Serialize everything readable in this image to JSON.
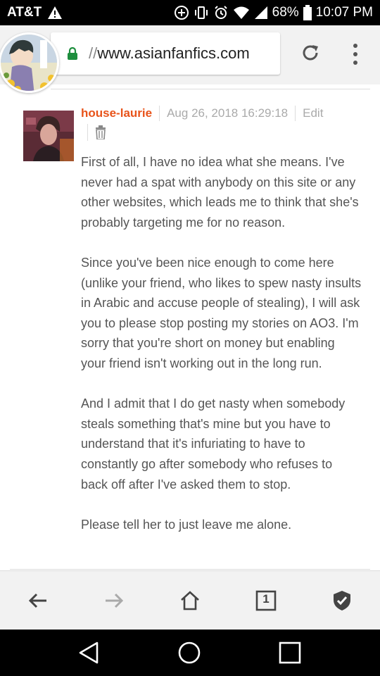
{
  "status_bar": {
    "carrier": "AT&T",
    "battery": "68%",
    "time": "10:07 PM"
  },
  "browser": {
    "url_prefix": "//",
    "url_domain": "www.asianfanfics.com"
  },
  "comment": {
    "author": "house-laurie",
    "timestamp": "Aug 26, 2018 16:29:18",
    "edit_label": "Edit",
    "paragraphs": [
      "First of all, I have no idea what she means. I've never had a spat with anybody on this site or any other websites, which leads me to think that she's probably targeting me for no reason.",
      "Since you've been nice enough to come here (unlike your friend, who likes to spew nasty insults in Arabic and accuse people of stealing), I will ask you to please stop posting my stories on AO3. I'm sorry that you're short on money but enabling your friend isn't working out in the long run.",
      "And I admit that I do get nasty when somebody steals something that's mine but you have to understand that it's infuriating to have to constantly go after somebody who refuses to back off after I've asked them to stop.",
      "Please tell her to just leave me alone."
    ]
  },
  "toolbar": {
    "tab_count": "1"
  },
  "colors": {
    "author": "#e8531a",
    "lock": "#1e8e3e",
    "muted": "#aaaaaa",
    "body_text": "#555555"
  }
}
